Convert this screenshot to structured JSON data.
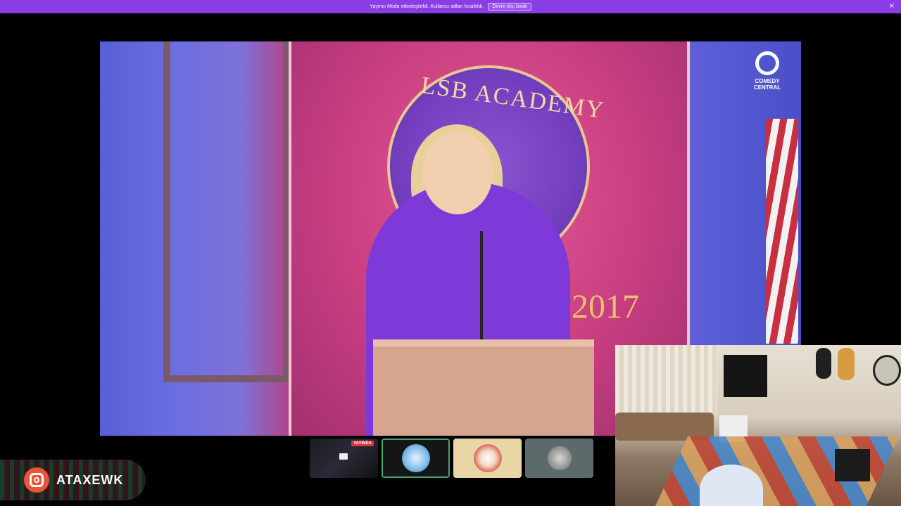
{
  "banner": {
    "message": "Yayıncı Modu etkinleştirildi. Kullanıcı adları kısaltıldı.",
    "button_label": "Devre dışı bırak",
    "close_glyph": "×"
  },
  "stage": {
    "channel_logo_text": "COMEDY CENTRAL",
    "backdrop_text": "LSB ACADEMY",
    "backdrop_year": "2017"
  },
  "participants": [
    {
      "kind": "screen-share",
      "badge": "YAYINDA",
      "icon": "monitor-icon"
    },
    {
      "kind": "avatar",
      "icon": "user-avatar",
      "active": true
    },
    {
      "kind": "avatar",
      "icon": "user-avatar"
    },
    {
      "kind": "avatar",
      "icon": "user-avatar"
    }
  ],
  "social": {
    "platform_icon": "instagram-icon",
    "handle": "ATAXEWK"
  },
  "colors": {
    "banner": "#8a3ce6",
    "live": "#e0323c",
    "active_border": "#3fa86a",
    "instagram": "#e8553a"
  }
}
